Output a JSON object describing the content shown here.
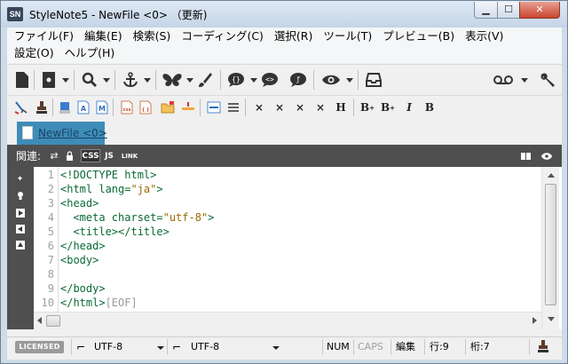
{
  "window": {
    "app_icon": "SN",
    "title": "StyleNote5 - NewFile <0> （更新)",
    "buttons": {
      "minimize": "minimize-icon",
      "maximize": "maximize-icon",
      "close": "close-icon"
    }
  },
  "menubar": {
    "row1": [
      "ファイル(F)",
      "編集(E)",
      "検索(S)",
      "コーディング(C)",
      "選択(R)",
      "ツール(T)",
      "プレビュー(B)",
      "表示(V)"
    ],
    "row2": [
      "設定(O)",
      "ヘルプ(H)"
    ]
  },
  "toolbar1": {
    "icons": [
      "new-file-icon",
      "open-file-icon",
      "search-icon",
      "anchor-icon",
      "butterfly-icon",
      "brush-icon",
      "comment-icon",
      "comment-code-icon",
      "comment-script-icon",
      "preview-eye-icon",
      "inbox-icon",
      "voicemail-icon",
      "wrench-icon"
    ]
  },
  "toolbar2": {
    "bold_h": "H",
    "bold_b": "B",
    "italic": "I",
    "x_marks": [
      "×",
      "×",
      "×",
      "×"
    ]
  },
  "tabs": [
    {
      "label": "NewFile <0>"
    }
  ],
  "related_bar": {
    "label": "関連:",
    "css_badge": "CSS",
    "js_badge": "JS",
    "link_badge": "LINK"
  },
  "editor": {
    "line_numbers": [
      "1",
      "2",
      "3",
      "4",
      "5",
      "6",
      "7",
      "8",
      "9",
      "10"
    ],
    "lines": [
      {
        "pre": "<!DOCTYPE html>",
        "str": "",
        "post": ""
      },
      {
        "pre": "<html lang=",
        "str": "\"ja\"",
        "post": ">"
      },
      {
        "pre": "<head>",
        "str": "",
        "post": ""
      },
      {
        "pre": "  <meta charset=",
        "str": "\"utf-8\"",
        "post": ">"
      },
      {
        "pre": "  <title></title>",
        "str": "",
        "post": ""
      },
      {
        "pre": "</head>",
        "str": "",
        "post": ""
      },
      {
        "pre": "<body>",
        "str": "",
        "post": ""
      },
      {
        "pre": "",
        "str": "",
        "post": ""
      },
      {
        "pre": "</body>",
        "str": "",
        "post": ""
      },
      {
        "pre": "</html>",
        "str": "",
        "post": "[EOF]"
      }
    ]
  },
  "statusbar": {
    "license": "LICENSED",
    "encoding_left": "UTF-8",
    "encoding_right": "UTF-8",
    "num": "NUM",
    "caps": "CAPS",
    "mode": "編集",
    "row": "行:9",
    "col": "桁:7"
  }
}
